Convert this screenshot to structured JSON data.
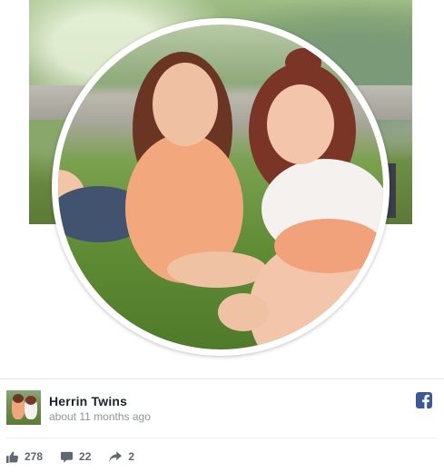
{
  "post": {
    "author": "Herrin Twins",
    "timestamp": "about 11 months ago",
    "likes": "278",
    "comments": "22",
    "shares": "2"
  },
  "icons": {
    "social": "facebook-icon",
    "like": "thumbs-up-icon",
    "comment": "comment-icon",
    "share": "share-arrow-icon"
  },
  "colors": {
    "facebook_blue": "#3b5998",
    "muted_text": "#90949c",
    "stat_text": "#606770"
  }
}
